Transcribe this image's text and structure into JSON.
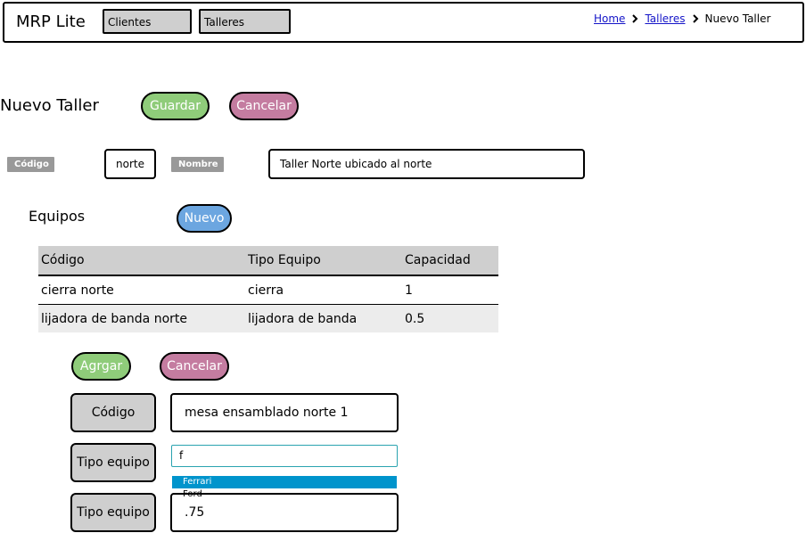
{
  "header": {
    "app_title": "MRP Lite",
    "nav": [
      "Clientes",
      "Talleres"
    ],
    "breadcrumb": [
      "Home",
      "Talleres",
      "Nuevo Taller"
    ]
  },
  "page": {
    "title": "Nuevo Taller",
    "save_label": "Guardar",
    "cancel_label": "Cancelar"
  },
  "form": {
    "codigo_label": "Código",
    "codigo_value": "norte",
    "nombre_label": "Nombre",
    "nombre_value": "Taller Norte ubicado al norte"
  },
  "equipos": {
    "title": "Equipos",
    "new_label": "Nuevo",
    "columns": [
      "Código",
      "Tipo Equipo",
      "Capacidad"
    ],
    "rows": [
      [
        "cierra norte",
        "cierra",
        "1"
      ],
      [
        "lijadora de banda norte",
        "lijadora de banda",
        "0.5"
      ]
    ]
  },
  "add_form": {
    "add_label": "Agrgar",
    "cancel_label": "Cancelar",
    "codigo_label": "Código",
    "codigo_value": "mesa ensamblado norte 1",
    "tipo_label": "Tipo equipo",
    "tipo_input": "f",
    "dropdown_options": [
      "Ferrari",
      "Ford"
    ],
    "capacidad_label": "Tipo equipo",
    "capacidad_value": ".75"
  },
  "colors": {
    "green_button": "#8fcc7a",
    "pink_button": "#c47ca0",
    "blue_button": "#6ca6e0",
    "dropdown_highlight": "#0094cc",
    "link": "#1515c8"
  }
}
